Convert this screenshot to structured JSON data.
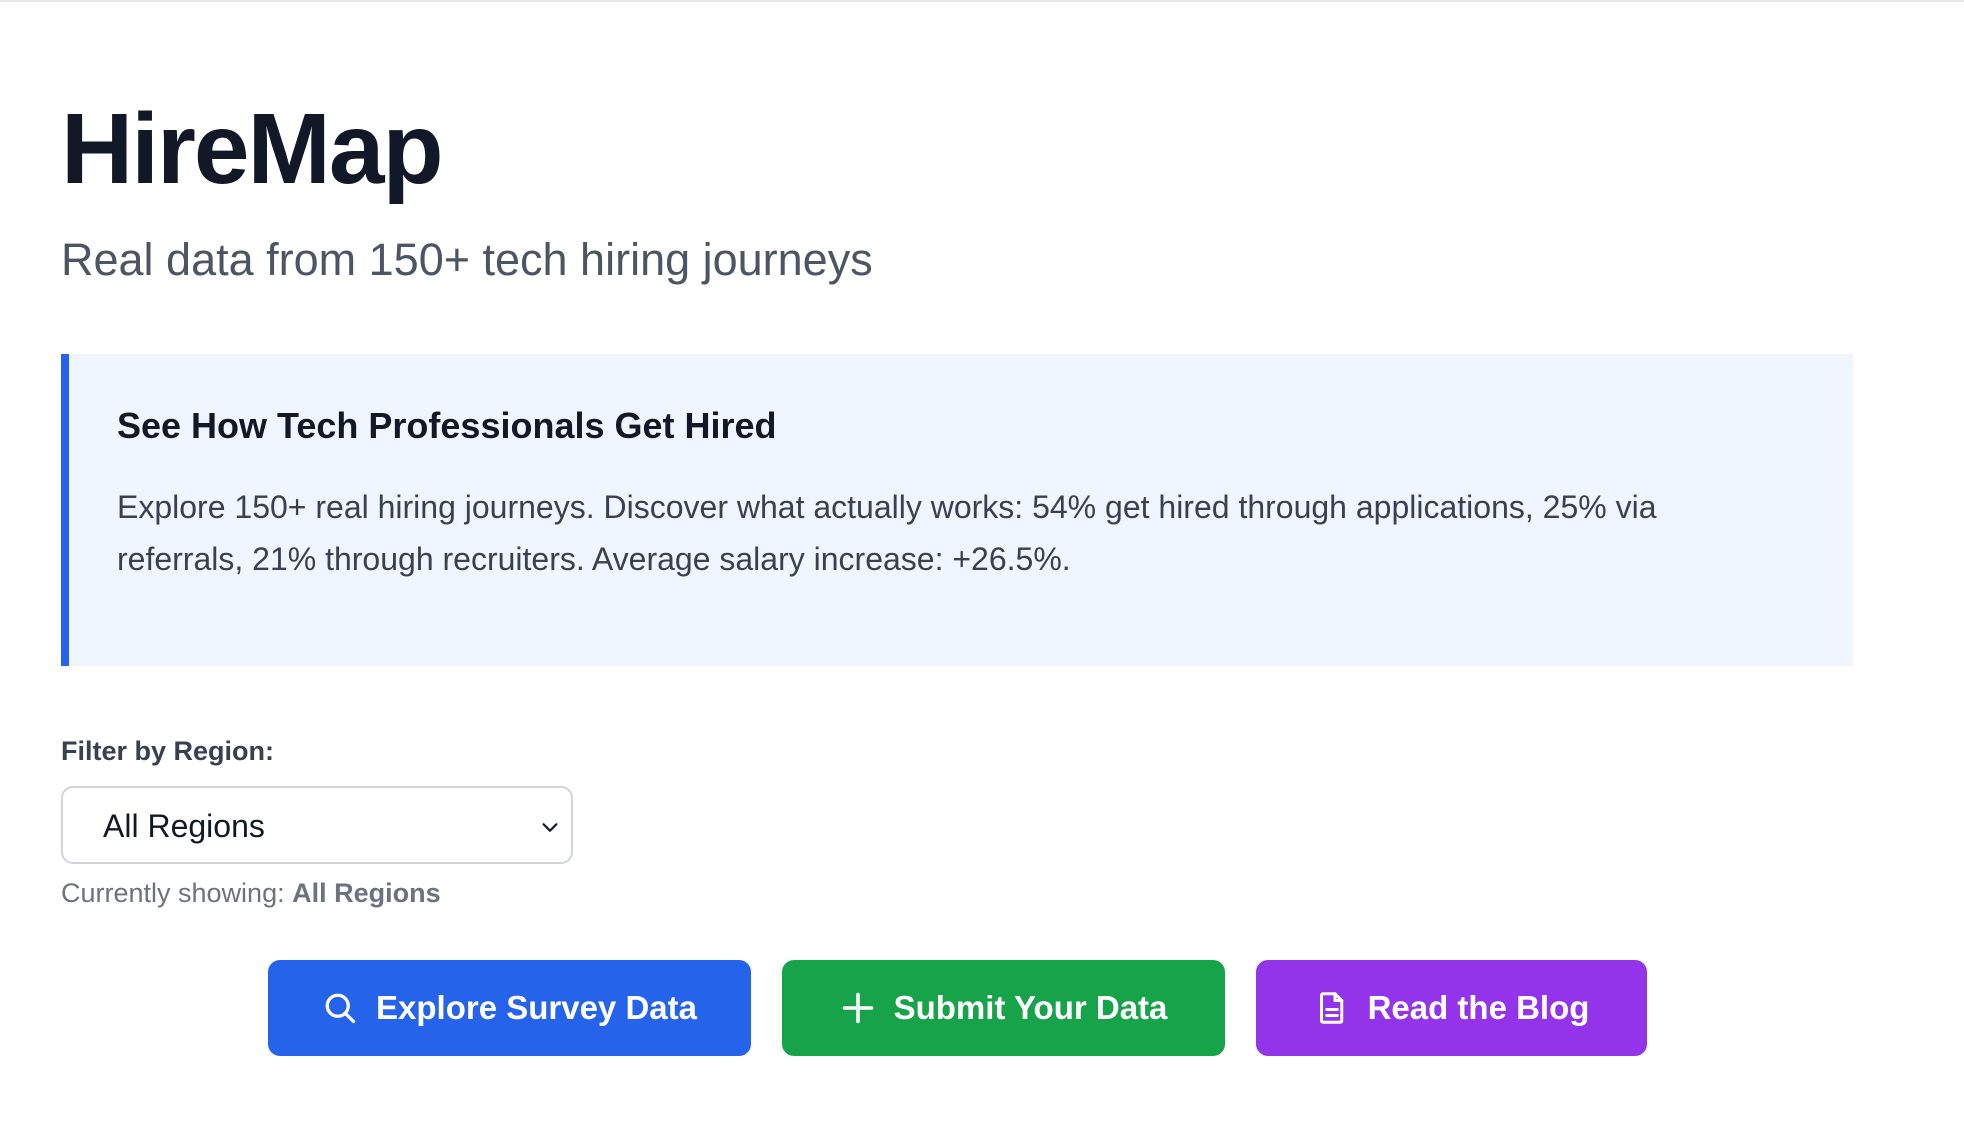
{
  "header": {
    "title": "HireMap",
    "subtitle": "Real data from 150+ tech hiring journeys"
  },
  "callout": {
    "title": "See How Tech Professionals Get Hired",
    "text": "Explore 150+ real hiring journeys. Discover what actually works: 54% get hired through applications, 25% via referrals, 21% through recruiters. Average salary increase: +26.5%."
  },
  "filter": {
    "label": "Filter by Region:",
    "selected": "All Regions",
    "showing_prefix": "Currently showing:",
    "showing_value": "All Regions"
  },
  "actions": {
    "explore_label": "Explore Survey Data",
    "submit_label": "Submit Your Data",
    "blog_label": "Read the Blog",
    "explore_icon": "search-icon",
    "submit_icon": "plus-icon",
    "blog_icon": "document-icon"
  },
  "colors": {
    "accent_blue": "#2563eb",
    "accent_green": "#16a34a",
    "accent_purple": "#9333ea",
    "callout_bg": "#eff6ff"
  }
}
